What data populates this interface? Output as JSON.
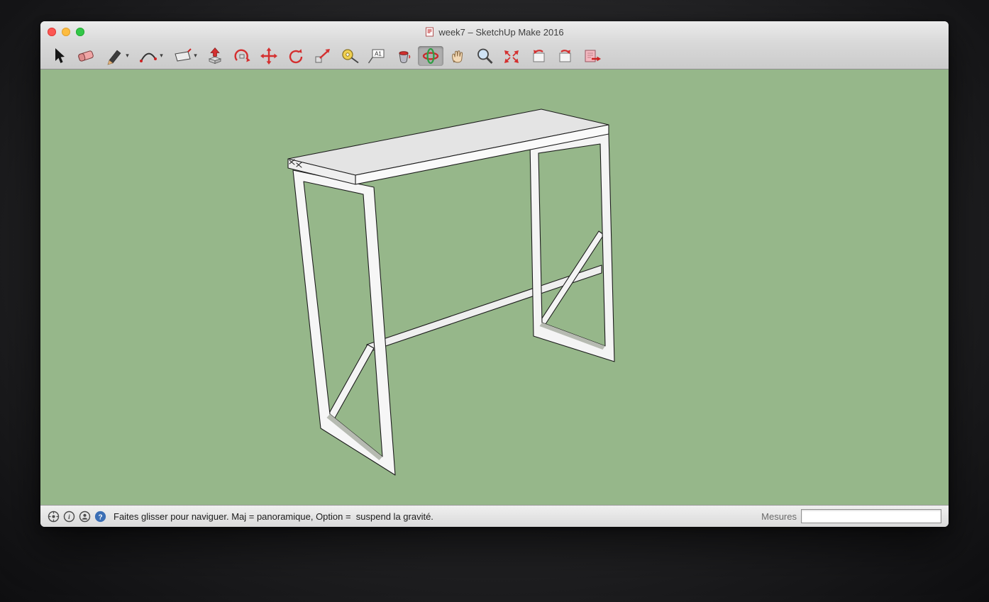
{
  "window": {
    "title": "week7 – SketchUp Make 2016"
  },
  "toolbar": {
    "text_tool_glyph": "A1",
    "tools": [
      {
        "name": "select-tool",
        "active": false,
        "dropdown": false
      },
      {
        "name": "eraser-tool",
        "active": false,
        "dropdown": false
      },
      {
        "name": "line-tool",
        "active": false,
        "dropdown": true
      },
      {
        "name": "arc-tool",
        "active": false,
        "dropdown": true
      },
      {
        "name": "shape-tool",
        "active": false,
        "dropdown": true
      },
      {
        "name": "pushpull-tool",
        "active": false,
        "dropdown": false
      },
      {
        "name": "offset-tool",
        "active": false,
        "dropdown": false
      },
      {
        "name": "move-tool",
        "active": false,
        "dropdown": false
      },
      {
        "name": "rotate-tool",
        "active": false,
        "dropdown": false
      },
      {
        "name": "scale-tool",
        "active": false,
        "dropdown": false
      },
      {
        "name": "tape-measure-tool",
        "active": false,
        "dropdown": false
      },
      {
        "name": "text-tool",
        "active": false,
        "dropdown": false
      },
      {
        "name": "paint-bucket-tool",
        "active": false,
        "dropdown": false
      },
      {
        "name": "orbit-tool",
        "active": true,
        "dropdown": false
      },
      {
        "name": "pan-tool",
        "active": false,
        "dropdown": false
      },
      {
        "name": "zoom-tool",
        "active": false,
        "dropdown": false
      },
      {
        "name": "zoom-extents-tool",
        "active": false,
        "dropdown": false
      },
      {
        "name": "previous-view-tool",
        "active": false,
        "dropdown": false
      },
      {
        "name": "next-view-tool",
        "active": false,
        "dropdown": false
      },
      {
        "name": "share-model-tool",
        "active": false,
        "dropdown": false
      }
    ]
  },
  "viewport": {
    "background_color": "#96b78a",
    "model_description": "white console table frame with two rectangular leg frames, long stretcher bar and diagonal braces"
  },
  "statusbar": {
    "hint": "Faites glisser pour naviguer. Maj = panoramique, Option =  suspend la gravité.",
    "measures_label": "Mesures",
    "measures_value": ""
  },
  "colors": {
    "accent_red": "#d42f2f",
    "viewport_green": "#96b78a",
    "chrome_gray": "#d9d9d9"
  }
}
